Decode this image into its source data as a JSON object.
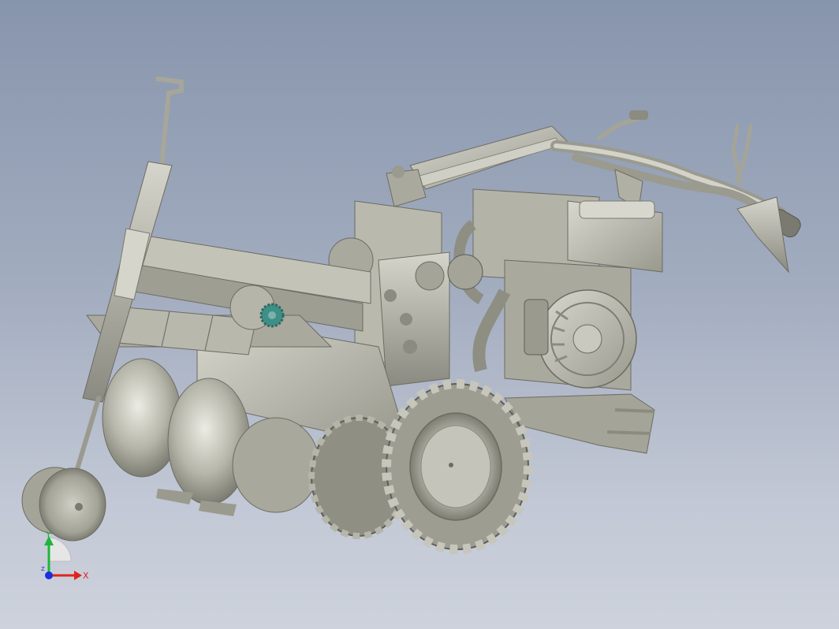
{
  "viewport": {
    "model_description_hidden": "",
    "background_top": "#8795ac",
    "background_bottom": "#cdd2dc"
  },
  "model": {
    "body_color": "#b9b9ad",
    "shade_color": "#8f8f84",
    "dark_color": "#5e5e56",
    "highlight_color": "#e4e4dc",
    "sprocket_color": "#3f8f86"
  },
  "triad": {
    "x_label": "X",
    "y_label": "Y",
    "z_label": "Z",
    "x_color": "#e0231b",
    "y_color": "#1fb53a",
    "z_color": "#1a2ee0"
  }
}
